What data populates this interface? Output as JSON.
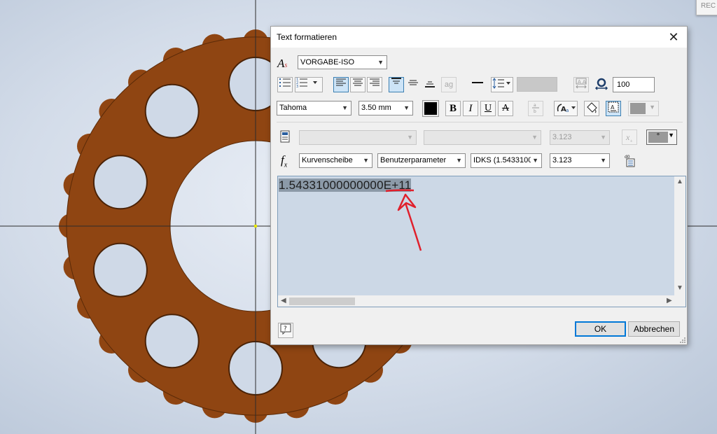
{
  "dialog": {
    "title": "Text formatieren",
    "style_combo": "VORGABE-ISO",
    "spacing_value": "100",
    "font_combo": "Tahoma",
    "size_combo": "3.50 mm",
    "param_row": {
      "disabled_value": "3.123",
      "symbol_button": "°"
    },
    "fx_row": {
      "component": "Kurvenscheibe",
      "param_type": "Benutzerparameter",
      "parameter": "IDKS (1.5433100",
      "precision": "3.123"
    },
    "text_content": {
      "prefix": "1.54331000000000",
      "exponent": "E+11"
    },
    "ok_label": "OK",
    "cancel_label": "Abbrechen",
    "toolbar_icons": {
      "bold": "B",
      "italic": "I",
      "underline": "U",
      "strike": "A",
      "abbr": "ag"
    }
  },
  "colors": {
    "part_fill": "#8f4512",
    "annotation": "#e0202c",
    "accent": "#0078d7"
  }
}
